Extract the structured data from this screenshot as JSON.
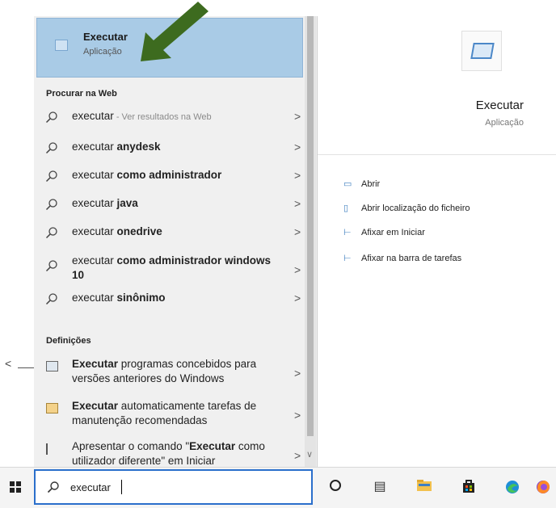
{
  "caption": "Windows 10",
  "results": {
    "best_match": {
      "title": "Executar",
      "subtitle": "Aplicação"
    },
    "web_section_label": "Procurar na Web",
    "web_items": [
      {
        "prefix": "executar",
        "bold": "",
        "suffix": " - Ver resultados na Web"
      },
      {
        "prefix": "executar ",
        "bold": "anydesk",
        "suffix": ""
      },
      {
        "prefix": "executar ",
        "bold": "como administrador",
        "suffix": ""
      },
      {
        "prefix": "executar ",
        "bold": "java",
        "suffix": ""
      },
      {
        "prefix": "executar ",
        "bold": "onedrive",
        "suffix": ""
      },
      {
        "prefix": "executar ",
        "bold": "como administrador windows 10",
        "suffix": ""
      },
      {
        "prefix": "executar ",
        "bold": "sinônimo",
        "suffix": ""
      }
    ],
    "settings_section_label": "Definições",
    "settings_items": [
      {
        "bold": "Executar",
        "text": " programas concebidos para versões anteriores do Windows"
      },
      {
        "bold": "Executar",
        "text": " automaticamente tarefas de manutenção recomendadas"
      },
      {
        "pre": "Apresentar o comando \"",
        "bold": "Executar",
        "text": " como utilizador diferente\" em Iniciar"
      }
    ]
  },
  "detail": {
    "title": "Executar",
    "subtitle": "Aplicação",
    "actions": [
      "Abrir",
      "Abrir localização do ficheiro",
      "Afixar em Iniciar",
      "Afixar na barra de tarefas"
    ]
  },
  "taskbar": {
    "search_value": "executar",
    "icons": [
      "cortana-icon",
      "task-view-icon",
      "file-explorer-icon",
      "store-icon",
      "edge-icon",
      "firefox-icon"
    ]
  },
  "colors": {
    "highlight": "#a9cbe6",
    "arrow": "#3d6b1f",
    "search_border": "#2a6fcb"
  }
}
